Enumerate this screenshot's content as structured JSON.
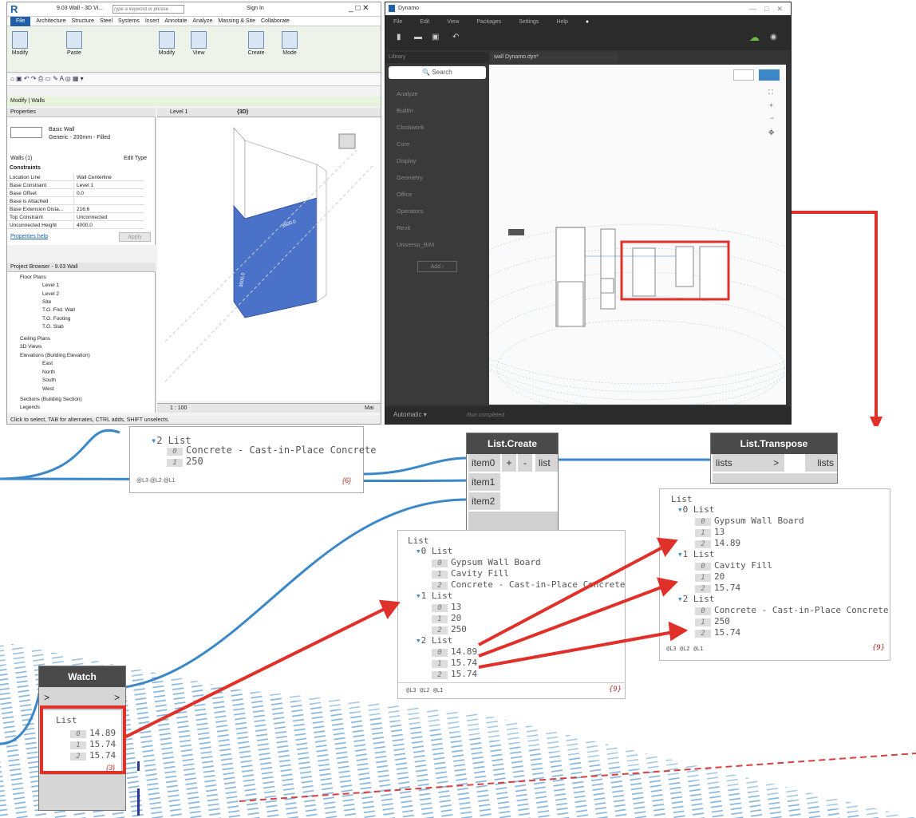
{
  "revit": {
    "title": "9.03 Wall - 3D Vi...",
    "search_placeholder": "Type a keyword or phrase",
    "sign_in": "Sign In",
    "menu": [
      "File",
      "Architecture",
      "Structure",
      "Steel",
      "Systems",
      "Insert",
      "Annotate",
      "Analyze",
      "Massing & Site",
      "Collaborate"
    ],
    "ribbon": {
      "modify": "Modify",
      "paste": "Paste",
      "modify2": "Modify",
      "view": "View",
      "create": "Create",
      "mode": "Mode"
    },
    "context": "Modify | Walls",
    "properties": {
      "header": "Properties",
      "type_name": "Basic Wall",
      "type_sub": "Generic - 200mm - Filled",
      "walls_count": "Walls (1)",
      "edit_type": "Edit Type",
      "constraints": "Constraints",
      "rows": [
        {
          "k": "Location Line",
          "v": "Wall Centerline"
        },
        {
          "k": "Base Constraint",
          "v": "Level 1"
        },
        {
          "k": "Base Offset",
          "v": "0.0"
        },
        {
          "k": "Base is Attached",
          "v": ""
        },
        {
          "k": "Base Extension Dista...",
          "v": "216.6"
        },
        {
          "k": "Top Constraint",
          "v": "Unconnected"
        },
        {
          "k": "Unconnected Height",
          "v": "4000.0"
        }
      ],
      "help": "Properties help",
      "apply": "Apply"
    },
    "browser": {
      "header": "Project Browser - 9.03 Wall",
      "items": [
        "Floor Plans",
        "Level 1",
        "Level 2",
        "Site",
        "T.O. Fnd. Wall",
        "T.O. Footing",
        "T.O. Slab",
        "Ceiling Plans",
        "3D Views",
        "Elevations (Building Elevation)",
        "East",
        "North",
        "South",
        "West",
        "Sections (Building Section)",
        "Legends"
      ]
    },
    "tabs": {
      "level1": "Level 1",
      "view3d": "{3D}"
    },
    "scale": "1 : 100",
    "dim1": "3600.0",
    "dim2": "3600.0",
    "status": "Click to select, TAB for alternates, CTRL adds, SHIFT unselects.",
    "main_label": "Mai"
  },
  "dynamo": {
    "title": "Dynamo",
    "menu": [
      "File",
      "Edit",
      "View",
      "Packages",
      "Settings",
      "Help"
    ],
    "library_label": "Library",
    "file_tab": "wall Dynamo.dyn*",
    "search": "Search",
    "library": [
      "Analyze",
      "BuiltIn",
      "Clockwork",
      "Core",
      "Display",
      "Geometry",
      "Office",
      "Operators",
      "Revit",
      "Universo_BIM"
    ],
    "add": "Add",
    "run_mode": "Automatic",
    "run_status": "Run completed"
  },
  "zoom": {
    "topnode": {
      "list_label": "2 List",
      "items": [
        {
          "i": "0",
          "v": "Concrete - Cast-in-Place Concrete"
        },
        {
          "i": "1",
          "v": "250"
        }
      ],
      "levels": "@L3 @L2 @L1",
      "count": "{6}"
    },
    "list_create": {
      "title": "List.Create",
      "inputs": [
        "item0",
        "item1",
        "item2"
      ],
      "output": "list",
      "plus": "+",
      "minus": "-"
    },
    "list_transpose": {
      "title": "List.Transpose",
      "input": "lists",
      "output": "lists",
      "arrow": ">"
    },
    "middle": {
      "root": "List",
      "groups": [
        {
          "label": "0 List",
          "items": [
            {
              "i": "0",
              "v": "Gypsum Wall Board"
            },
            {
              "i": "1",
              "v": "Cavity Fill"
            },
            {
              "i": "2",
              "v": "Concrete - Cast-in-Place Concrete"
            }
          ]
        },
        {
          "label": "1 List",
          "items": [
            {
              "i": "0",
              "v": "13"
            },
            {
              "i": "1",
              "v": "20"
            },
            {
              "i": "2",
              "v": "250"
            }
          ]
        },
        {
          "label": "2 List",
          "items": [
            {
              "i": "0",
              "v": "14.89"
            },
            {
              "i": "1",
              "v": "15.74"
            },
            {
              "i": "2",
              "v": "15.74"
            }
          ]
        }
      ],
      "levels": "@L3 @L2 @L1",
      "count": "{9}"
    },
    "right": {
      "root": "List",
      "groups": [
        {
          "label": "0 List",
          "items": [
            {
              "i": "0",
              "v": "Gypsum Wall Board"
            },
            {
              "i": "1",
              "v": "13"
            },
            {
              "i": "2",
              "v": "14.89"
            }
          ]
        },
        {
          "label": "1 List",
          "items": [
            {
              "i": "0",
              "v": "Cavity Fill"
            },
            {
              "i": "1",
              "v": "20"
            },
            {
              "i": "2",
              "v": "15.74"
            }
          ]
        },
        {
          "label": "2 List",
          "items": [
            {
              "i": "0",
              "v": "Concrete - Cast-in-Place Concrete"
            },
            {
              "i": "1",
              "v": "250"
            },
            {
              "i": "2",
              "v": "15.74"
            }
          ]
        }
      ],
      "levels": "@L3 @L2 @L1",
      "count": "{9}"
    },
    "watch": {
      "title": "Watch",
      "in": ">",
      "out": ">",
      "root": "List",
      "items": [
        {
          "i": "0",
          "v": "14.89"
        },
        {
          "i": "1",
          "v": "15.74"
        },
        {
          "i": "2",
          "v": "15.74"
        }
      ],
      "count": "{3}"
    }
  },
  "colors": {
    "highlight": "#e0302a",
    "wire": "#3b87c8",
    "wall": "#4a72c9",
    "node_header": "#4a4a4a"
  }
}
